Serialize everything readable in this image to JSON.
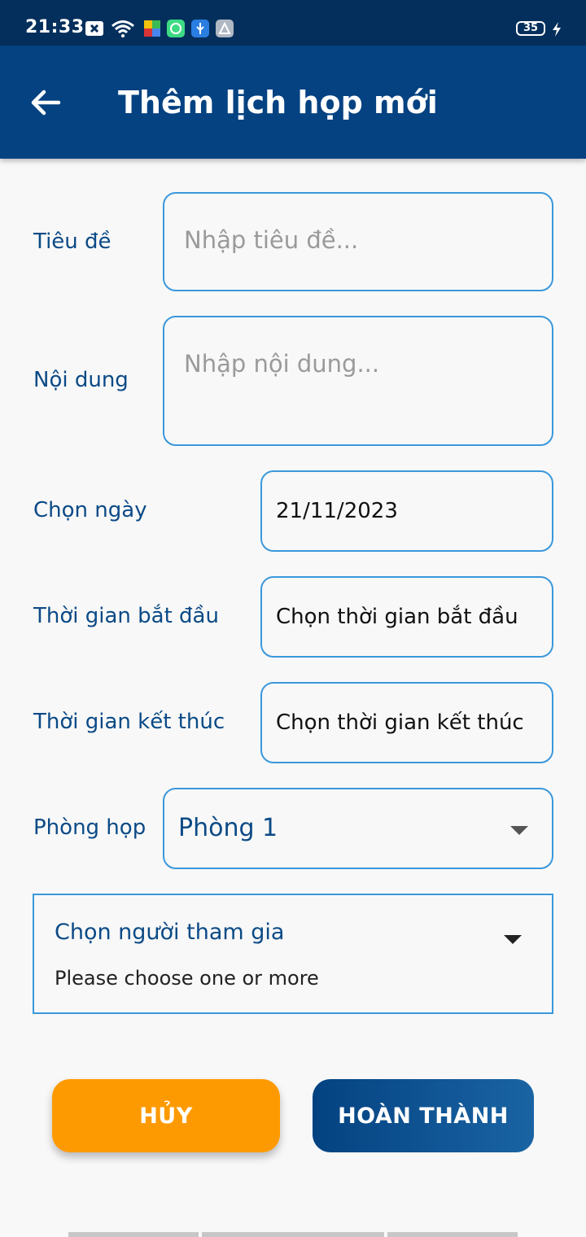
{
  "status_bar": {
    "time": "21:33",
    "battery": "35"
  },
  "app_bar": {
    "title": "Thêm lịch họp mới"
  },
  "form": {
    "title_label": "Tiêu đề",
    "title_placeholder": "Nhập tiêu đề...",
    "content_label": "Nội dung",
    "content_placeholder": "Nhập nội dung...",
    "date_label": "Chọn ngày",
    "date_value": "21/11/2023",
    "start_label": "Thời gian bắt đầu",
    "start_value": "Chọn thời gian bắt đầu",
    "end_label": "Thời gian kết thúc",
    "end_value": "Chọn thời gian kết thúc",
    "room_label": "Phòng họp",
    "room_value": "Phòng 1",
    "participants_label": "Chọn người tham gia",
    "participants_hint": "Please choose one or more"
  },
  "actions": {
    "cancel_label": "HỦY",
    "done_label": "HOÀN THÀNH"
  },
  "colors": {
    "primary": "#044281",
    "accent": "#fe9a01",
    "border": "#3a98dc"
  },
  "icons": [
    "back-arrow-icon",
    "dropdown-arrow-icon",
    "wifi-icon",
    "usb-icon"
  ]
}
